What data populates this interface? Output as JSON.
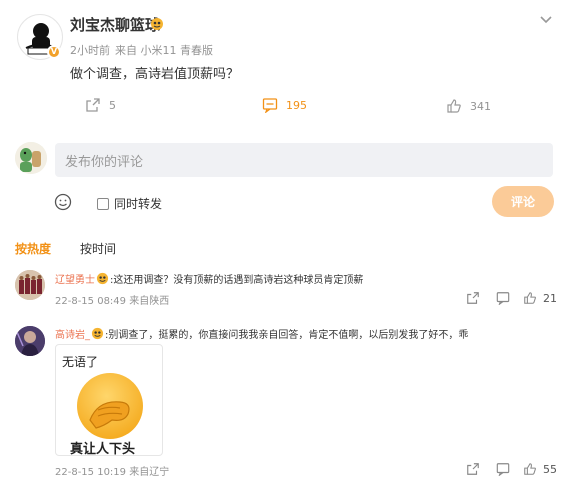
{
  "post": {
    "author": "刘宝杰聊篮球",
    "verified_badge": "V",
    "time": "2小时前",
    "source": "来自 小米11 青春版",
    "text": "做个调查，高诗岩值顶薪吗？",
    "reposts": "5",
    "comments": "195",
    "likes": "341"
  },
  "composer": {
    "placeholder": "发布你的评论",
    "also_repost_label": "同时转发",
    "submit_label": "评论"
  },
  "sort_tabs": {
    "hot": "按热度",
    "time": "按时间"
  },
  "comments": [
    {
      "user": "辽望勇士",
      "text": ":这还用调查？没有顶薪的话遇到高诗岩这种球员肯定顶薪",
      "time": "22-8-15 08:49",
      "location": "来自陕西",
      "likes": "21"
    },
    {
      "user": "高诗岩_",
      "text": ":别调查了，挺累的，你直接问我我亲自回答，肯定不值啊，以后别发我了好不，乖",
      "time": "22-8-15 10:19",
      "location": "来自辽宁",
      "likes": "55",
      "sticker": {
        "top_text": "无语了",
        "bottom_text": "真让人下头"
      }
    }
  ],
  "colors": {
    "accent_orange": "#f29116",
    "username": "#eb7350",
    "submit_disabled": "#fbcb98",
    "input_bg": "#f0f1f4"
  },
  "icons": {
    "more": "chevron-down-icon",
    "repost": "repost-icon",
    "comment": "comment-icon",
    "like": "thumbs-up-icon",
    "emoji": "emoji-icon"
  }
}
